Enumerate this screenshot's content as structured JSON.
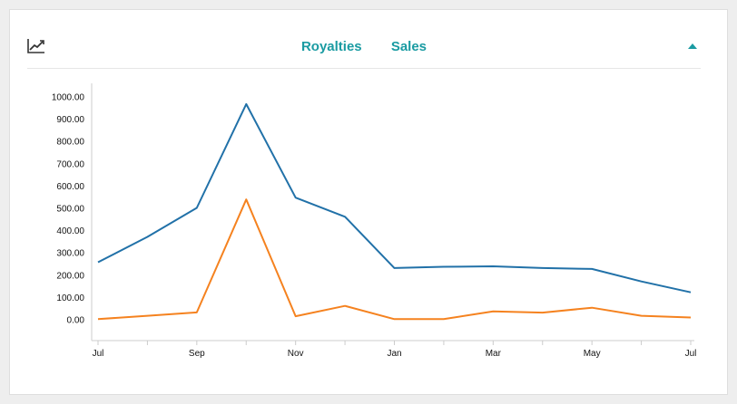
{
  "header": {
    "icon": "line-chart-icon",
    "tabs": [
      "Royalties",
      "Sales"
    ],
    "collapse_icon": "caret-up-icon",
    "accent_color": "#1a9ba2"
  },
  "chart_data": {
    "type": "line",
    "x_tick_labels": [
      "Jul",
      "Sep",
      "Nov",
      "Jan",
      "Mar",
      "May",
      "Jul"
    ],
    "y_tick_labels": [
      "0.00",
      "100.00",
      "200.00",
      "300.00",
      "400.00",
      "500.00",
      "600.00",
      "700.00",
      "800.00",
      "900.00",
      "1000.00"
    ],
    "ylim": [
      0,
      1000
    ],
    "series": [
      {
        "color": "#2171a8",
        "values": [
          258,
          372,
          502,
          968,
          548,
          462,
          232,
          238,
          240,
          232,
          228,
          172,
          123
        ]
      },
      {
        "color": "#f5821f",
        "values": [
          3,
          18,
          33,
          540,
          16,
          62,
          3,
          3,
          38,
          32,
          54,
          18,
          10
        ]
      }
    ],
    "grid": false,
    "legend": "none"
  }
}
